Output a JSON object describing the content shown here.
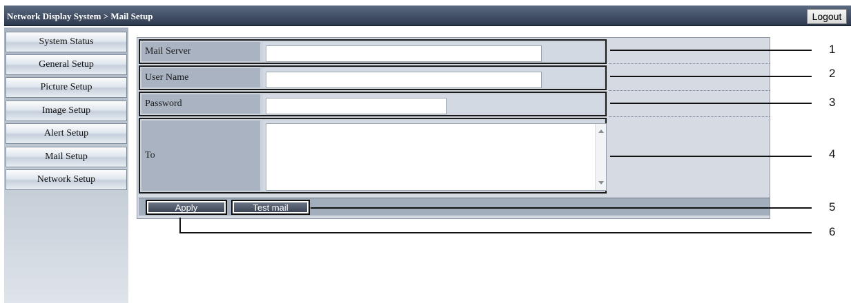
{
  "header": {
    "breadcrumb": "Network Display System > Mail Setup",
    "logout_label": "Logout"
  },
  "sidebar": {
    "items": [
      {
        "label": "System Status"
      },
      {
        "label": "General Setup"
      },
      {
        "label": "Picture Setup"
      },
      {
        "label": "Image Setup"
      },
      {
        "label": "Alert Setup"
      },
      {
        "label": "Mail Setup"
      },
      {
        "label": "Network Setup"
      }
    ]
  },
  "form": {
    "mail_server": {
      "label": "Mail Server",
      "value": ""
    },
    "user_name": {
      "label": "User Name",
      "value": ""
    },
    "password": {
      "label": "Password",
      "value": ""
    },
    "to": {
      "label": "To",
      "value": ""
    }
  },
  "buttons": {
    "apply_label": "Apply",
    "test_mail_label": "Test mail"
  },
  "callouts": [
    "1",
    "2",
    "3",
    "4",
    "5",
    "6"
  ],
  "colors": {
    "header": "#2f3b50",
    "sidebar": "#b9c2ce",
    "panel": "#d5dae3",
    "label_cell": "#a9b3c2",
    "button": "#4a5465"
  }
}
